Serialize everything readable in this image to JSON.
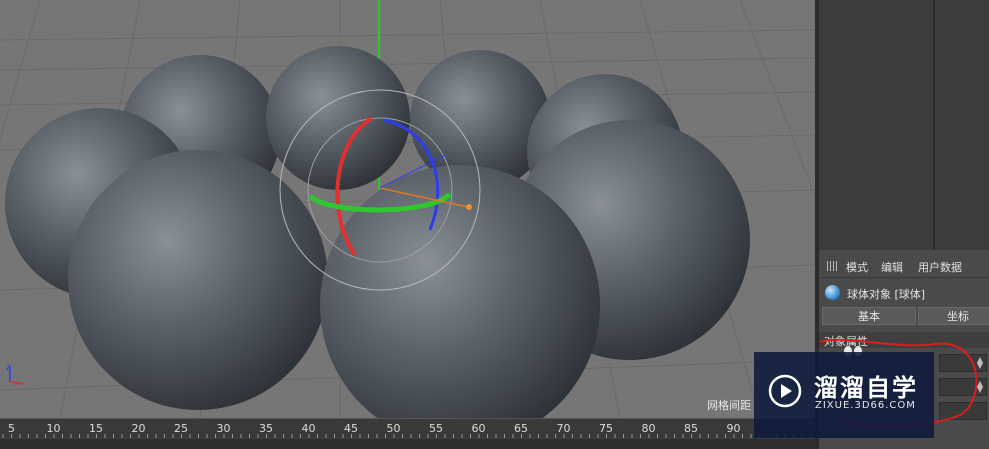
{
  "viewport": {
    "grid_label": "网格间距"
  },
  "attributes": {
    "menu": [
      "模式",
      "编辑",
      "用户数据"
    ],
    "object_label": "球体对象 [球体]",
    "tabs": [
      "基本",
      "坐标"
    ],
    "section_title": "对象属性"
  },
  "timeline": {
    "ticks": [
      "5",
      "10",
      "15",
      "20",
      "25",
      "30",
      "35",
      "40",
      "45",
      "50",
      "55",
      "60",
      "65",
      "70",
      "75",
      "80",
      "85",
      "90"
    ]
  },
  "watermark": {
    "brand": "溜溜自学",
    "site": "ZIXUE.3D66.COM"
  },
  "colors": {
    "viewport_bg": "#767676",
    "panel_bg": "#4a4a4a",
    "gizmo_x": "#e03030",
    "gizmo_y": "#2ec82e",
    "gizmo_z": "#2e3cf0",
    "annotation": "#d81e1e",
    "watermark_bg": "#0c1a3c"
  }
}
